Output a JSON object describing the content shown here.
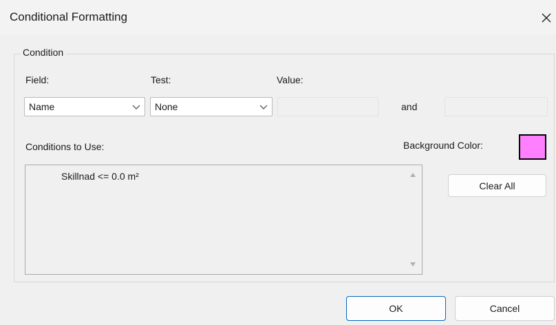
{
  "window": {
    "title": "Conditional Formatting"
  },
  "condition_group": {
    "label": "Condition",
    "field_label": "Field:",
    "test_label": "Test:",
    "value_label": "Value:",
    "field_selected": "Name",
    "test_selected": "None",
    "value_from": "",
    "and_label": "and",
    "value_to": "",
    "conditions_label": "Conditions to Use:",
    "background_color_label": "Background Color:",
    "background_color": "#ff80ff",
    "conditions": [
      "Skillnad <= 0.0 m²"
    ],
    "clear_all_label": "Clear All"
  },
  "buttons": {
    "ok_label": "OK",
    "cancel_label": "Cancel"
  },
  "icons": {
    "close": "close-icon",
    "chevron": "chevron-down-icon",
    "scroll_up": "scroll-up-arrow-icon",
    "scroll_down": "scroll-down-arrow-icon"
  }
}
